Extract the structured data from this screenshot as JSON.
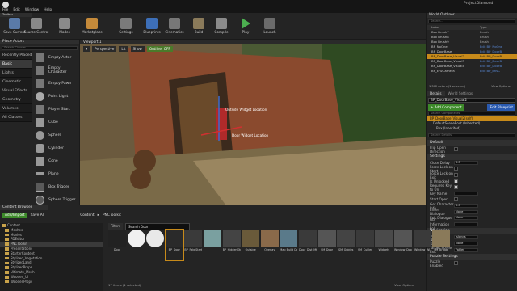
{
  "menu": {
    "items": [
      "File",
      "Edit",
      "Window",
      "Help"
    ],
    "project": "ProjectDiamond"
  },
  "toolbar": {
    "title": "Toolbar",
    "buttons": [
      "Save Current",
      "Source Control",
      "Modes",
      "Marketplace",
      "Settings",
      "Blueprints",
      "Cinematics",
      "Build",
      "Compile",
      "Play",
      "Launch"
    ]
  },
  "place_actors": {
    "title": "Place Actors",
    "search_placeholder": "Search Classes",
    "categories": [
      "Recently Placed",
      "Basic",
      "Lights",
      "Cinematic",
      "Visual Effects",
      "Geometry",
      "Volumes",
      "All Classes"
    ],
    "actors": [
      "Empty Actor",
      "Empty Character",
      "Empty Pawn",
      "Point Light",
      "Player Start",
      "Cube",
      "Sphere",
      "Cylinder",
      "Cone",
      "Plane",
      "Box Trigger",
      "Sphere Trigger"
    ]
  },
  "viewport": {
    "tab": "Viewport 1",
    "perspective": "Perspective",
    "lit": "Lit",
    "show": "Show",
    "outline": "Outline: OFF",
    "labels": [
      "Outside Widget Location",
      "Door Widget Location"
    ]
  },
  "world_outliner": {
    "title": "World Outliner",
    "search_placeholder": "Search...",
    "col_label": "Label",
    "col_type": "Type",
    "rows": [
      [
        "Box Brush7",
        "Brush"
      ],
      [
        "Box Brush8",
        "Brush"
      ],
      [
        "Box Brush9",
        "Brush"
      ],
      [
        "BP_NoOne",
        "Edit BP_NoOne"
      ],
      [
        "BP_DoorBase",
        "Edit BP_DoorB"
      ],
      [
        "BP_DoorBase_Visual2",
        "Edit BP_DoorB"
      ],
      [
        "BP_DoorBase_Visual3",
        "Edit BP_DoorB"
      ],
      [
        "BP_DoorBase_Visual4",
        "Edit BP_DoorB"
      ],
      [
        "BP_EnvCamera",
        "Edit BP_EnvC"
      ]
    ],
    "footer": "1,302 actors (1 selected)",
    "view_options": "View Options"
  },
  "details": {
    "tab_details": "Details",
    "tab_world": "World Settings",
    "actor_name": "BP_DoorBase_Visual2",
    "add_component": "+ Add Component",
    "edit_blueprint": "Edit Blueprint",
    "search_placeholder": "Search Components",
    "components": [
      "BP_DoorBase_Visual2(self)",
      "DefaultSceneRoot (Inherited)",
      "Box (Inherited)"
    ],
    "search_details": "Search Details",
    "sections": [
      {
        "name": "Default",
        "props": [
          [
            "Flip Open Direction",
            "chk0"
          ]
        ]
      },
      {
        "name": "Settings",
        "props": [
          [
            "Close Delay",
            "0.0"
          ],
          [
            "Force Lock on Start",
            "chk0"
          ],
          [
            "Force Lock on Exit",
            "chk0"
          ],
          [
            "Is Unlocked",
            "chk1"
          ],
          [
            "Requires Key to Un",
            "chk1"
          ],
          [
            "Key Name",
            ""
          ],
          [
            "Start Open",
            "chk0"
          ],
          [
            "Get Character Info",
            "0.0"
          ],
          [
            "Enter Dialogue",
            "None"
          ],
          [
            "Exit Dialogue",
            "None"
          ],
          [
            "NPC Information Fol",
            ""
          ]
        ]
      },
      {
        "name": "Navigation",
        "props": [
          [
            "Load Scene Name",
            "Islands"
          ],
          [
            "Target Slow",
            "None"
          ],
          [
            "Target Scene Exit",
            "Fakler"
          ]
        ]
      },
      {
        "name": "Puzzle Settings",
        "props": [
          [
            "Puzzle Enabled",
            "chk0"
          ]
        ]
      }
    ]
  },
  "content_browser": {
    "title": "Content Browser",
    "add_import": "Add/Import",
    "save_all": "Save All",
    "path": [
      "Content",
      "PNCToolkit"
    ],
    "filters": "Filters",
    "search_placeholder": "Search Door",
    "folders": [
      "Content",
      "Meshes",
      "Movies",
      "PDEditor",
      "PNCToolkit",
      "Presentations",
      "StarterContent",
      "Stylized_Vegetation",
      "StylizedLand",
      "StylizedProps",
      "Ultimate_Mesh",
      "Wooden_UI",
      "WoodenProps"
    ],
    "assets": [
      "Door",
      "",
      "",
      "BP_Door",
      "BP_FakeStarts",
      "",
      "BP_HiddenObjects",
      "Outside",
      "Overlay",
      "Map Build Data Registry",
      "Door_Dist_Mtl",
      "SM_Door",
      "SM_Guides",
      "SM_Cuiller",
      "Widgets",
      "Window_Door",
      "Window_Wi",
      "SM_Bridge"
    ],
    "status": "17 items (1 selected)",
    "view_options": "View Options"
  }
}
